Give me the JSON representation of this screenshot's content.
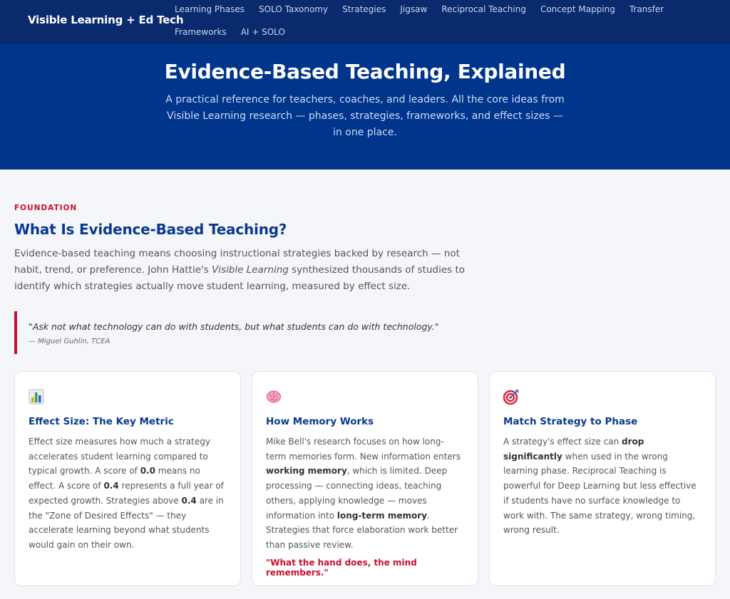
{
  "nav": {
    "brand": "Visible Learning + Ed Tech",
    "links": [
      "Learning Phases",
      "SOLO Taxonomy",
      "Strategies",
      "Jigsaw",
      "Reciprocal Teaching",
      "Concept Mapping",
      "Transfer",
      "Frameworks",
      "AI + SOLO"
    ]
  },
  "hero": {
    "title": "Evidence-Based Teaching, Explained",
    "subtitle": "A practical reference for teachers, coaches, and leaders. All the core ideas from Visible Learning research — phases, strategies, frameworks, and effect sizes — in one place."
  },
  "foundation": {
    "eyebrow": "FOUNDATION",
    "title": "What Is Evidence-Based Teaching?",
    "intro": {
      "part1": "Evidence-based teaching means choosing instructional strategies backed by research — not habit, trend, or preference. John Hattie's ",
      "italic": "Visible Learning",
      "part2": " synthesized thousands of studies to identify which strategies actually move student learning, measured by effect size."
    },
    "quote": {
      "text": "\"Ask not what technology can do with students, but what students can do with technology.\"",
      "cite": "— Miguel Guhlin, TCEA"
    }
  },
  "cards": [
    {
      "icon": "bar-chart-icon",
      "title": "Effect Size: The Key Metric",
      "body": [
        "Effect size measures how much a strategy accelerates student learning compared to typical growth. A score of ",
        "0.0",
        " means no effect. A score of ",
        "0.4",
        " represents a full year of expected growth. Strategies above ",
        "0.4",
        " are in the \"Zone of Desired Effects\" — they accelerate learning beyond what students would gain on their own."
      ]
    },
    {
      "icon": "brain-icon",
      "title": "How Memory Works",
      "body": [
        "Mike Bell's research focuses on how long-term memories form. New information enters ",
        "working memory",
        ", which is limited. Deep processing — connecting ideas, teaching others, applying knowledge — moves information into ",
        "long-term memory",
        ". Strategies that force elaboration work better than passive review."
      ],
      "quote": "\"What the hand does, the mind remembers.\""
    },
    {
      "icon": "target-icon",
      "title": "Match Strategy to Phase",
      "body": [
        "A strategy's effect size can ",
        "drop significantly",
        " when used in the wrong learning phase. Reciprocal Teaching is powerful for Deep Learning but less effective if students have no surface knowledge to work with. The same strategy, wrong timing, wrong result."
      ]
    }
  ]
}
